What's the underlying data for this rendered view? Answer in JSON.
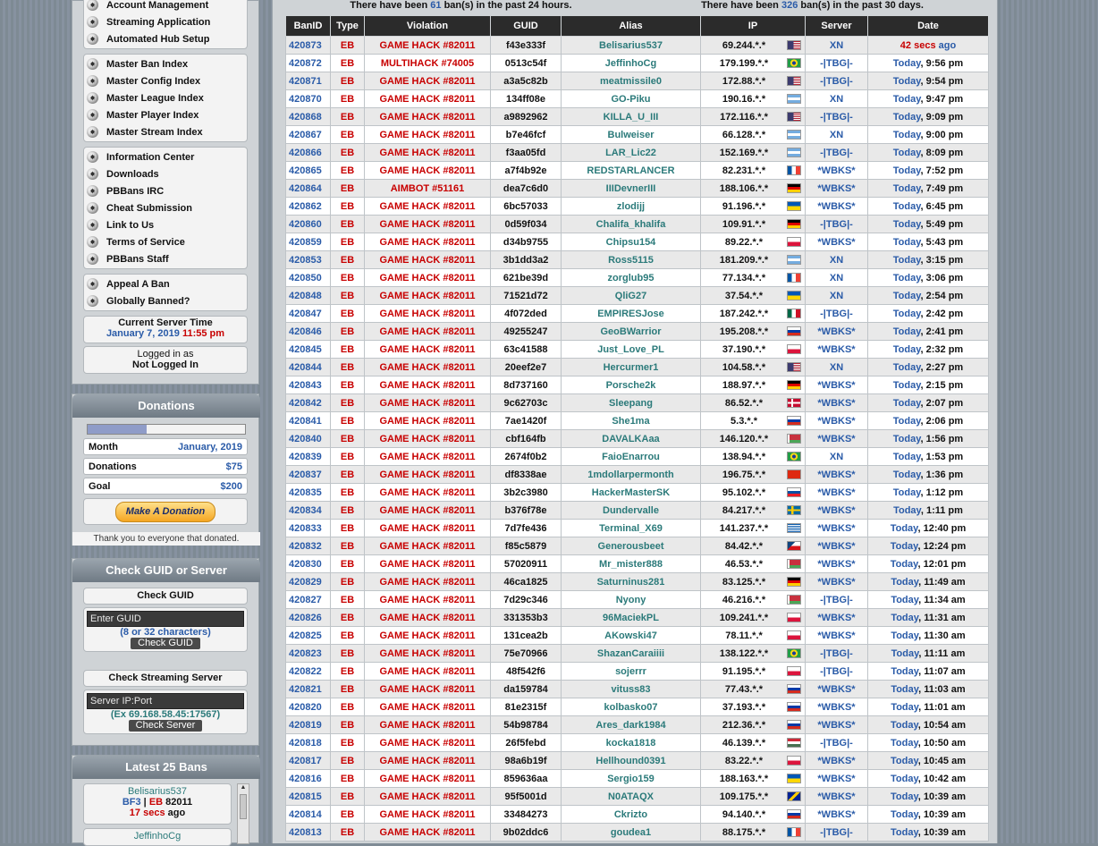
{
  "sidebar": {
    "menu1": [
      "Account Management",
      "Streaming Application",
      "Automated Hub Setup"
    ],
    "menu2": [
      "Master Ban Index",
      "Master Config Index",
      "Master League Index",
      "Master Player Index",
      "Master Stream Index"
    ],
    "menu3": [
      "Information Center",
      "Downloads",
      "PBBans IRC",
      "Cheat Submission",
      "Link to Us",
      "Terms of Service",
      "PBBans Staff"
    ],
    "menu4": [
      "Appeal A Ban",
      "Globally Banned?"
    ],
    "server_time_label": "Current Server Time",
    "server_date": "January 7, 2019",
    "server_clock": "11:55 pm",
    "logged_label": "Logged in as",
    "logged_user": "Not Logged In"
  },
  "donations": {
    "title": "Donations",
    "progress": 0.375,
    "month_label": "Month",
    "month_value": "January, 2019",
    "donations_label": "Donations",
    "donations_value": "$75",
    "goal_label": "Goal",
    "goal_value": "$200",
    "button_label": "Make A Donation",
    "thanks": "Thank you to everyone that donated."
  },
  "check": {
    "title": "Check GUID or Server",
    "guid_heading": "Check GUID",
    "guid_placeholder": "Enter GUID",
    "guid_hint": "(8 or 32 characters)",
    "guid_button": "Check GUID",
    "server_heading": "Check Streaming Server",
    "server_placeholder": "Server IP:Port",
    "server_hint": "(Ex 69.168.58.45:17567)",
    "server_button": "Check Server"
  },
  "latest": {
    "title": "Latest 25 Bans",
    "first_alias": "Belisarius537",
    "first_game": "BF3",
    "first_type": "EB",
    "first_code": "82011",
    "first_age_num": "17 secs",
    "first_age_word": "ago",
    "second_alias": "JeffinhoCg"
  },
  "summary": {
    "day_prefix": "There have been ",
    "day_count": "61",
    "day_suffix": " ban(s) in the past 24 hours.",
    "month_prefix": "There have been ",
    "month_count": "326",
    "month_suffix": " ban(s) in the past 30 days."
  },
  "table": {
    "headers": [
      "BanID",
      "Type",
      "Violation",
      "GUID",
      "Alias",
      "IP",
      "Server",
      "Date"
    ],
    "rows": [
      [
        "420873",
        "EB",
        "GAME HACK #82011",
        "f43e333f",
        "Belisarius537",
        "69.244.*.*",
        "us",
        "XN",
        "42 secs",
        "ago"
      ],
      [
        "420872",
        "EB",
        "MULTIHACK #74005",
        "0513c54f",
        "JeffinhoCg",
        "179.199.*.*",
        "br",
        "-|TBG|-",
        "Today",
        ", 9:56 pm"
      ],
      [
        "420871",
        "EB",
        "GAME HACK #82011",
        "a3a5c82b",
        "meatmissile0",
        "172.88.*.*",
        "us",
        "-|TBG|-",
        "Today",
        ", 9:54 pm"
      ],
      [
        "420870",
        "EB",
        "GAME HACK #82011",
        "134ff08e",
        "GO-Piku",
        "190.16.*.*",
        "ar",
        "XN",
        "Today",
        ", 9:47 pm"
      ],
      [
        "420868",
        "EB",
        "GAME HACK #82011",
        "a9892962",
        "KILLA_U_III",
        "172.116.*.*",
        "us",
        "-|TBG|-",
        "Today",
        ", 9:09 pm"
      ],
      [
        "420867",
        "EB",
        "GAME HACK #82011",
        "b7e46fcf",
        "Bulweiser",
        "66.128.*.*",
        "ar",
        "XN",
        "Today",
        ", 9:00 pm"
      ],
      [
        "420866",
        "EB",
        "GAME HACK #82011",
        "f3aa05fd",
        "LAR_Lic22",
        "152.169.*.*",
        "ar",
        "-|TBG|-",
        "Today",
        ", 8:09 pm"
      ],
      [
        "420865",
        "EB",
        "GAME HACK #82011",
        "a7f4b92e",
        "REDSTARLANCER",
        "82.231.*.*",
        "fr",
        "*WBKS*",
        "Today",
        ", 7:52 pm"
      ],
      [
        "420864",
        "EB",
        "AIMBOT #51161",
        "dea7c6d0",
        "IIIDevnerIII",
        "188.106.*.*",
        "de",
        "*WBKS*",
        "Today",
        ", 7:49 pm"
      ],
      [
        "420862",
        "EB",
        "GAME HACK #82011",
        "6bc57033",
        "zlodijj",
        "91.196.*.*",
        "ua",
        "*WBKS*",
        "Today",
        ", 6:45 pm"
      ],
      [
        "420860",
        "EB",
        "GAME HACK #82011",
        "0d59f034",
        "Chalifa_khalifa",
        "109.91.*.*",
        "de",
        "-|TBG|-",
        "Today",
        ", 5:49 pm"
      ],
      [
        "420859",
        "EB",
        "GAME HACK #82011",
        "d34b9755",
        "Chipsu154",
        "89.22.*.*",
        "pl",
        "*WBKS*",
        "Today",
        ", 5:43 pm"
      ],
      [
        "420853",
        "EB",
        "GAME HACK #82011",
        "3b1dd3a2",
        "Ross5115",
        "181.209.*.*",
        "ar",
        "XN",
        "Today",
        ", 3:15 pm"
      ],
      [
        "420850",
        "EB",
        "GAME HACK #82011",
        "621be39d",
        "zorglub95",
        "77.134.*.*",
        "fr",
        "XN",
        "Today",
        ", 3:06 pm"
      ],
      [
        "420848",
        "EB",
        "GAME HACK #82011",
        "71521d72",
        "QliG27",
        "37.54.*.*",
        "ua",
        "XN",
        "Today",
        ", 2:54 pm"
      ],
      [
        "420847",
        "EB",
        "GAME HACK #82011",
        "4f072ded",
        "EMPIRESJose",
        "187.242.*.*",
        "mx",
        "-|TBG|-",
        "Today",
        ", 2:42 pm"
      ],
      [
        "420846",
        "EB",
        "GAME HACK #82011",
        "49255247",
        "GeoBWarrior",
        "195.208.*.*",
        "ru",
        "*WBKS*",
        "Today",
        ", 2:41 pm"
      ],
      [
        "420845",
        "EB",
        "GAME HACK #82011",
        "63c41588",
        "Just_Love_PL",
        "37.190.*.*",
        "pl",
        "*WBKS*",
        "Today",
        ", 2:32 pm"
      ],
      [
        "420844",
        "EB",
        "GAME HACK #82011",
        "20eef2e7",
        "Hercurmer1",
        "104.58.*.*",
        "us",
        "XN",
        "Today",
        ", 2:27 pm"
      ],
      [
        "420843",
        "EB",
        "GAME HACK #82011",
        "8d737160",
        "Porsche2k",
        "188.97.*.*",
        "de",
        "*WBKS*",
        "Today",
        ", 2:15 pm"
      ],
      [
        "420842",
        "EB",
        "GAME HACK #82011",
        "9c62703c",
        "Sleepang",
        "86.52.*.*",
        "dk",
        "*WBKS*",
        "Today",
        ", 2:07 pm"
      ],
      [
        "420841",
        "EB",
        "GAME HACK #82011",
        "7ae1420f",
        "She1ma",
        "5.3.*.*",
        "ru",
        "*WBKS*",
        "Today",
        ", 2:06 pm"
      ],
      [
        "420840",
        "EB",
        "GAME HACK #82011",
        "cbf164fb",
        "DAVALKAaa",
        "146.120.*.*",
        "by",
        "*WBKS*",
        "Today",
        ", 1:56 pm"
      ],
      [
        "420839",
        "EB",
        "GAME HACK #82011",
        "2674f0b2",
        "FaioEnarrou",
        "138.94.*.*",
        "br",
        "XN",
        "Today",
        ", 1:53 pm"
      ],
      [
        "420837",
        "EB",
        "GAME HACK #82011",
        "df8338ae",
        "1mdollarpermonth",
        "196.75.*.*",
        "cn",
        "*WBKS*",
        "Today",
        ", 1:36 pm"
      ],
      [
        "420835",
        "EB",
        "GAME HACK #82011",
        "3b2c3980",
        "HackerMasterSK",
        "95.102.*.*",
        "sk",
        "*WBKS*",
        "Today",
        ", 1:12 pm"
      ],
      [
        "420834",
        "EB",
        "GAME HACK #82011",
        "b376f78e",
        "Dundervalle",
        "84.217.*.*",
        "se",
        "*WBKS*",
        "Today",
        ", 1:11 pm"
      ],
      [
        "420833",
        "EB",
        "GAME HACK #82011",
        "7d7fe436",
        "Terminal_X69",
        "141.237.*.*",
        "gr",
        "*WBKS*",
        "Today",
        ", 12:40 pm"
      ],
      [
        "420832",
        "EB",
        "GAME HACK #82011",
        "f85c5879",
        "Generousbeet",
        "84.42.*.*",
        "cz",
        "*WBKS*",
        "Today",
        ", 12:24 pm"
      ],
      [
        "420830",
        "EB",
        "GAME HACK #82011",
        "57020911",
        "Mr_mister888",
        "46.53.*.*",
        "by",
        "*WBKS*",
        "Today",
        ", 12:01 pm"
      ],
      [
        "420829",
        "EB",
        "GAME HACK #82011",
        "46ca1825",
        "Saturninus281",
        "83.125.*.*",
        "de",
        "*WBKS*",
        "Today",
        ", 11:49 am"
      ],
      [
        "420827",
        "EB",
        "GAME HACK #82011",
        "7d29c346",
        "Nyony",
        "46.216.*.*",
        "by",
        "-|TBG|-",
        "Today",
        ", 11:34 am"
      ],
      [
        "420826",
        "EB",
        "GAME HACK #82011",
        "331353b3",
        "96MaciekPL",
        "109.241.*.*",
        "pl",
        "*WBKS*",
        "Today",
        ", 11:31 am"
      ],
      [
        "420825",
        "EB",
        "GAME HACK #82011",
        "131cea2b",
        "AKowski47",
        "78.11.*.*",
        "pl",
        "*WBKS*",
        "Today",
        ", 11:30 am"
      ],
      [
        "420823",
        "EB",
        "GAME HACK #82011",
        "75e70966",
        "ShazanCaraiiii",
        "138.122.*.*",
        "br",
        "-|TBG|-",
        "Today",
        ", 11:11 am"
      ],
      [
        "420822",
        "EB",
        "GAME HACK #82011",
        "48f542f6",
        "sojerrr",
        "91.195.*.*",
        "pl",
        "-|TBG|-",
        "Today",
        ", 11:07 am"
      ],
      [
        "420821",
        "EB",
        "GAME HACK #82011",
        "da159784",
        "vituss83",
        "77.43.*.*",
        "ru",
        "*WBKS*",
        "Today",
        ", 11:03 am"
      ],
      [
        "420820",
        "EB",
        "GAME HACK #82011",
        "81e2315f",
        "kolbasko07",
        "37.193.*.*",
        "ru",
        "*WBKS*",
        "Today",
        ", 11:01 am"
      ],
      [
        "420819",
        "EB",
        "GAME HACK #82011",
        "54b98784",
        "Ares_dark1984",
        "212.36.*.*",
        "ru",
        "*WBKS*",
        "Today",
        ", 10:54 am"
      ],
      [
        "420818",
        "EB",
        "GAME HACK #82011",
        "26f5febd",
        "kocka1818",
        "46.139.*.*",
        "hu",
        "-|TBG|-",
        "Today",
        ", 10:50 am"
      ],
      [
        "420817",
        "EB",
        "GAME HACK #82011",
        "98a6b19f",
        "Hellhound0391",
        "83.22.*.*",
        "pl",
        "*WBKS*",
        "Today",
        ", 10:45 am"
      ],
      [
        "420816",
        "EB",
        "GAME HACK #82011",
        "859636aa",
        "Sergio159",
        "188.163.*.*",
        "ua",
        "*WBKS*",
        "Today",
        ", 10:42 am"
      ],
      [
        "420815",
        "EB",
        "GAME HACK #82011",
        "95f5001d",
        "N0ATAQX",
        "109.175.*.*",
        "ba",
        "*WBKS*",
        "Today",
        ", 10:39 am"
      ],
      [
        "420814",
        "EB",
        "GAME HACK #82011",
        "33484273",
        "Ckrizto",
        "94.140.*.*",
        "ru",
        "*WBKS*",
        "Today",
        ", 10:39 am"
      ],
      [
        "420813",
        "EB",
        "GAME HACK #82011",
        "9b02ddc6",
        "goudea1",
        "88.175.*.*",
        "fr",
        "-|TBG|-",
        "Today",
        ", 10:39 am"
      ]
    ]
  },
  "colors": {
    "link_blue": "#2a5ba8",
    "violation_red": "#c80000",
    "alias_teal": "#2b7a7a",
    "header_dark": "#2b2b2b"
  }
}
